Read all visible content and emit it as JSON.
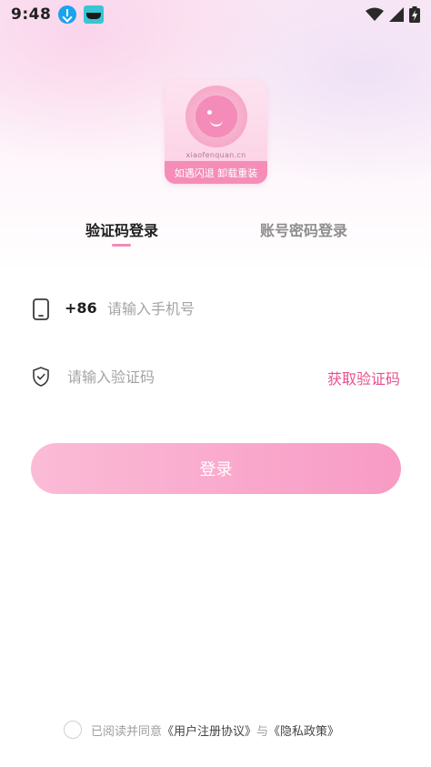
{
  "status_bar": {
    "time": "9:48",
    "left_icons": [
      "download-icon",
      "app-notification-icon"
    ],
    "right_icons": [
      "wifi-icon",
      "signal-icon",
      "battery-charging-icon"
    ]
  },
  "app_icon": {
    "url_text": "xiaofenquan.cn",
    "banner_text": "如遇闪退  卸载重装",
    "accent_color": "#f48bb8"
  },
  "tabs": [
    {
      "label": "验证码登录",
      "active": true
    },
    {
      "label": "账号密码登录",
      "active": false
    }
  ],
  "form": {
    "country_code": "+86",
    "phone_placeholder": "请输入手机号",
    "code_placeholder": "请输入验证码",
    "get_code_label": "获取验证码",
    "login_label": "登录"
  },
  "agreement": {
    "prefix": "已阅读并同意",
    "user_agreement": "《用户注册协议》",
    "conjunction": "与",
    "privacy_policy": "《隐私政策》"
  },
  "colors": {
    "accent": "#e94f8e",
    "button_start": "#fbbbd6",
    "button_end": "#f89bc5"
  }
}
